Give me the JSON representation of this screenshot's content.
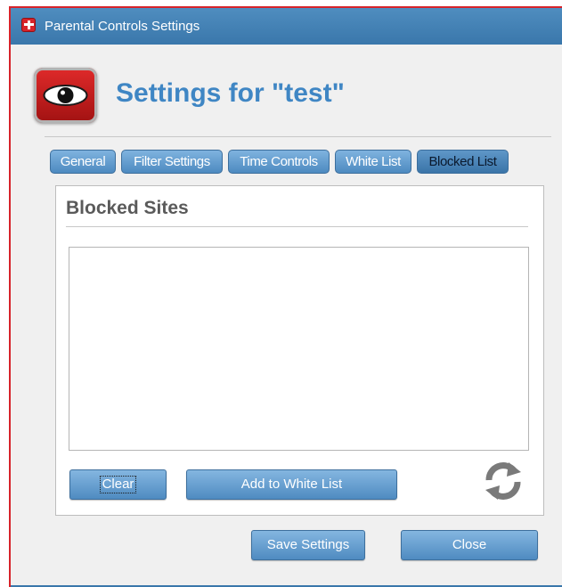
{
  "window": {
    "title": "Parental Controls Settings"
  },
  "header": {
    "title": "Settings for \"test\""
  },
  "tabs": [
    {
      "label": "General"
    },
    {
      "label": "Filter Settings"
    },
    {
      "label": "Time Controls"
    },
    {
      "label": "White List"
    },
    {
      "label": "Blocked List"
    }
  ],
  "active_tab": "Blocked List",
  "panel": {
    "title": "Blocked Sites",
    "blocked_sites": [],
    "clear_label": "Clear",
    "add_to_white_list_label": "Add to White List",
    "refresh_icon": "refresh-icon"
  },
  "footer": {
    "save_label": "Save Settings",
    "close_label": "Close"
  },
  "colors": {
    "titlebar": "#3f7fb4",
    "accent_title": "#3f86c4",
    "window_border": "#d7232a",
    "button": "#5f97c8"
  }
}
